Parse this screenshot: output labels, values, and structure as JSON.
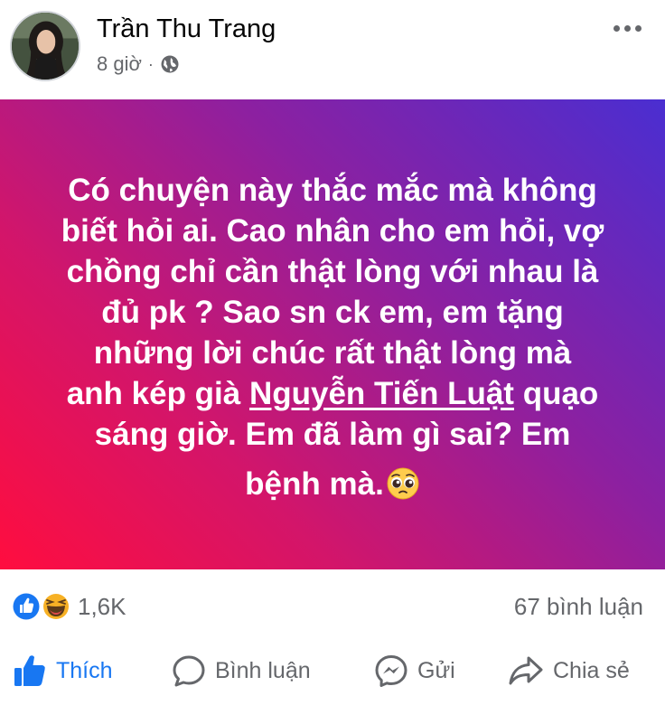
{
  "post": {
    "author": "Trần Thu Trang",
    "time": "8 giờ",
    "separator": "·",
    "privacy_icon": "globe-icon",
    "text_line1": "Có chuyện này thắc mắc mà không",
    "text_line2": "biết hỏi ai. Cao nhân cho em hỏi, vợ",
    "text_line3": "chồng chỉ cần thật lòng với nhau là",
    "text_line4": "đủ pk ? Sao sn ck em, em tặng",
    "text_line5": "những lời chúc  rất thật lòng mà",
    "text_line6_pre": "anh kép già ",
    "mention": "Nguyễn Tiến Luật",
    "text_line6_post": " quạo",
    "text_line7": "sáng giờ. Em đã làm gì sai? Em",
    "text_line8": "bệnh mà.",
    "emoji_icon": "pleading-face-emoji",
    "gradient_colors": [
      "#ff0d3f",
      "#d3156a",
      "#8d20a0",
      "#4a2ed1"
    ]
  },
  "reactions": {
    "icons": [
      "like-icon",
      "haha-icon"
    ],
    "count": "1,6K",
    "comments": "67 bình luận"
  },
  "actions": {
    "like": "Thích",
    "comment": "Bình luận",
    "send": "Gửi",
    "share": "Chia sẻ"
  },
  "colors": {
    "accent": "#1877f2",
    "secondary_text": "#65676b"
  }
}
